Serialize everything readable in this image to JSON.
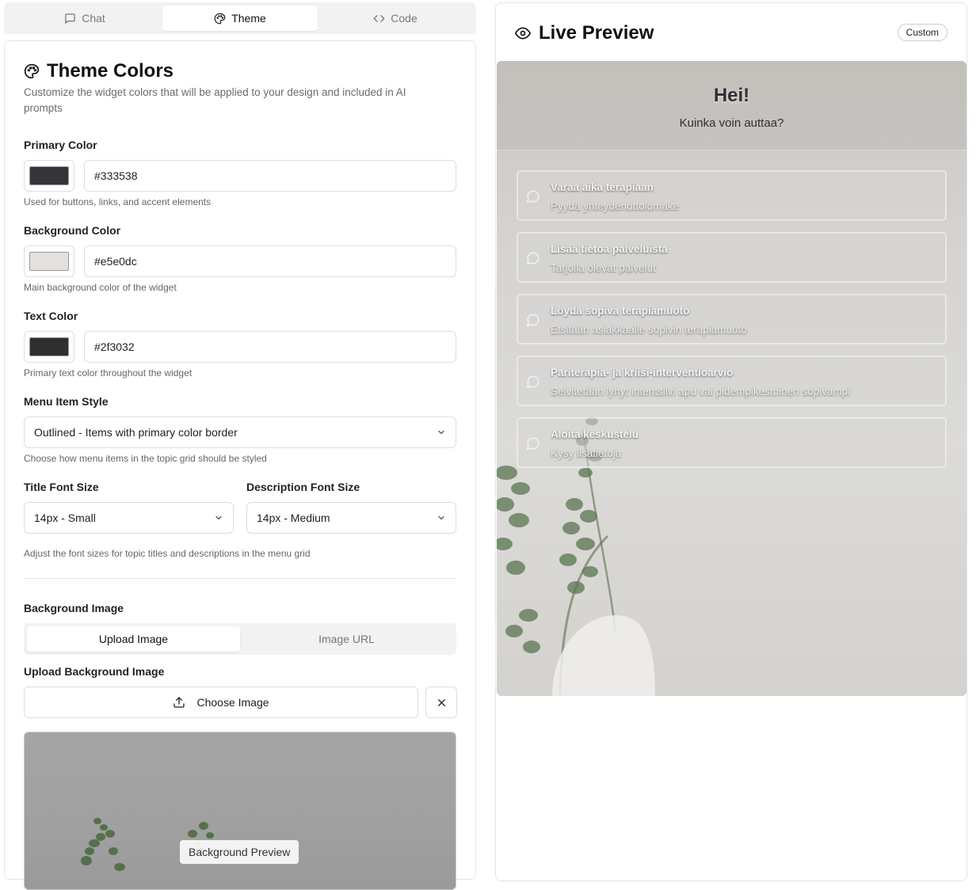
{
  "tabs": [
    {
      "label": "Chat",
      "icon": "message-square-icon"
    },
    {
      "label": "Theme",
      "icon": "palette-icon"
    },
    {
      "label": "Code",
      "icon": "code-icon"
    }
  ],
  "active_tab": "Theme",
  "theme": {
    "title": "Theme Colors",
    "subtitle": "Customize the widget colors that will be applied to your design and included in AI prompts",
    "primary": {
      "label": "Primary Color",
      "value": "#333538",
      "help": "Used for buttons, links, and accent elements",
      "swatch": "#333538"
    },
    "background": {
      "label": "Background Color",
      "value": "#e5e0dc",
      "help": "Main background color of the widget",
      "swatch": "#e5e0dc"
    },
    "text": {
      "label": "Text Color",
      "value": "#2f3032",
      "help": "Primary text color throughout the widget",
      "swatch": "#2f3032"
    },
    "menu_style": {
      "label": "Menu Item Style",
      "value": "Outlined - Items with primary color border",
      "help": "Choose how menu items in the topic grid should be styled"
    },
    "title_font": {
      "label": "Title Font Size",
      "value": "14px - Small"
    },
    "desc_font": {
      "label": "Description Font Size",
      "value": "14px - Medium"
    },
    "font_help": "Adjust the font sizes for topic titles and descriptions in the menu grid",
    "bg_image": {
      "label": "Background Image",
      "upload_tab": "Upload Image",
      "url_tab": "Image URL",
      "upload_label": "Upload Background Image",
      "choose_label": "Choose Image",
      "preview_caption": "Background Preview"
    }
  },
  "preview": {
    "title": "Live Preview",
    "badge": "Custom",
    "greeting": "Hei!",
    "subgreeting": "Kuinka voin auttaa?",
    "items": [
      {
        "title": "Varaa aika terapiaan",
        "desc": "Pyydä yhteydenottolomake"
      },
      {
        "title": "Lisää tietoa palveluista",
        "desc": "Tarjolla olevat palvelut"
      },
      {
        "title": "Löydä sopiva terapiamuoto",
        "desc": "Etsitään asiakkaalle sopivin terapiamuoto"
      },
      {
        "title": "Pariterapia- ja kriisi-interventioarvio",
        "desc": "Selvitetään lyhyt intentsiivi apu vai pidempikestoinen sopivampi"
      },
      {
        "title": "Aloita keskustelu",
        "desc": "Kysy lisätietoja"
      }
    ]
  }
}
